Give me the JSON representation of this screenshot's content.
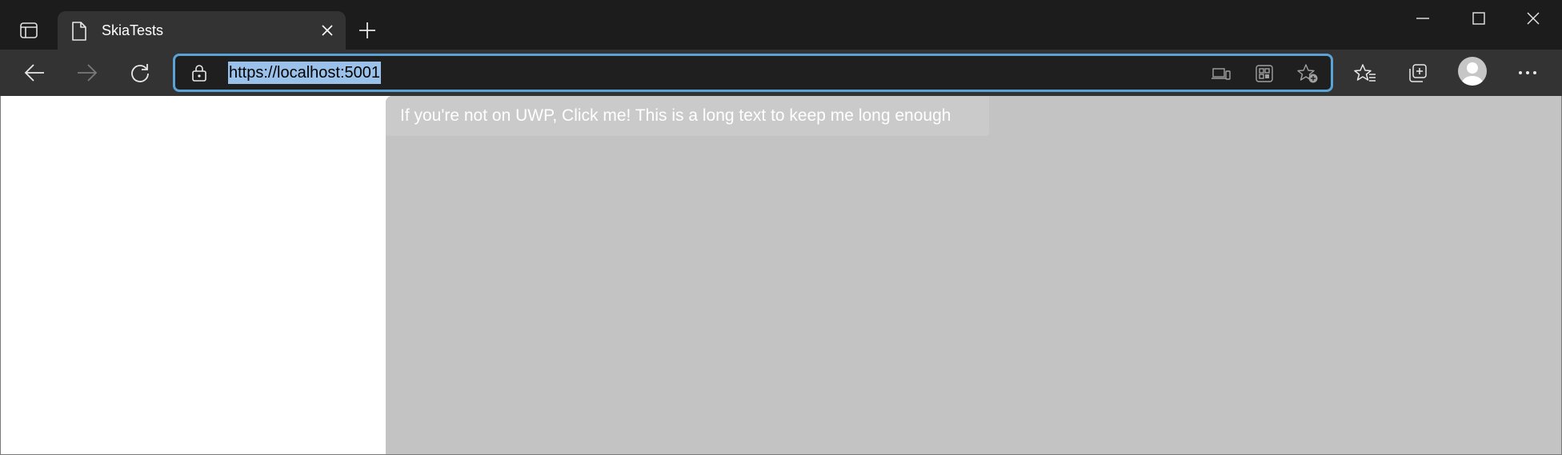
{
  "browser": {
    "tab": {
      "title": "SkiaTests"
    },
    "address_bar": {
      "url": "https://localhost:5001"
    },
    "accent_color": "#5aa3d6",
    "selection_color": "#99c1ea"
  },
  "icons": {
    "tab_actions": "tab-actions-icon",
    "page": "page-icon",
    "close": "close-icon",
    "new_tab": "plus-icon",
    "minimize": "minimize-icon",
    "maximize": "maximize-icon",
    "window_close": "window-close-icon",
    "back": "back-arrow-icon",
    "forward": "forward-arrow-icon",
    "refresh": "refresh-icon",
    "lock": "lock-icon",
    "app_available": "app-available-icon",
    "qr_code": "qr-code-icon",
    "add_favorite": "add-favorite-icon",
    "favorites": "favorites-icon",
    "collections": "collections-icon",
    "profile": "profile-avatar-icon",
    "more": "more-icon"
  },
  "page": {
    "button_text": "If you're not on UWP, Click me! This is a long text to keep me long enough",
    "left_pane_bg": "#ffffff",
    "right_pane_bg": "#c3c3c3",
    "button_bg": "#cacaca"
  }
}
